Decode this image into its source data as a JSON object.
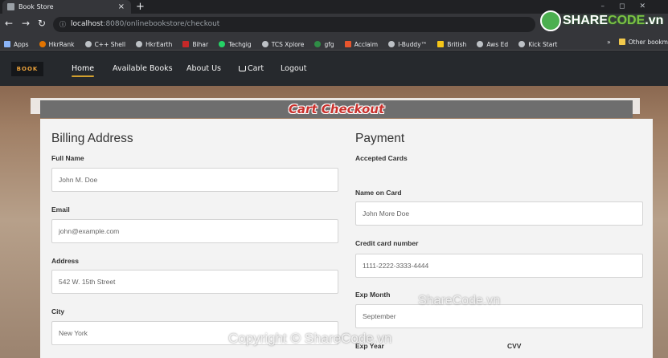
{
  "browser": {
    "tab_title": "Book Store",
    "tab_close": "×",
    "new_tab": "+",
    "url_host": "localhost",
    "url_rest": ":8080/onlinebookstore/checkout",
    "bookmarks": [
      "Apps",
      "HkrRank",
      "C++ Shell",
      "HkrEarth",
      "Bihar",
      "Techgig",
      "TCS Xplore",
      "gfg",
      "Acclaim",
      "I-Buddy™",
      "British",
      "Aws Ed",
      "Kick Start"
    ],
    "bookmarks_more": "»",
    "other_bookmarks": "Other bookm"
  },
  "navbar": {
    "brand": "BOOK",
    "links": [
      "Home",
      "Available Books",
      "About Us",
      "Cart",
      "Logout"
    ]
  },
  "checkout": {
    "title": "Cart Checkout",
    "billing": {
      "heading": "Billing Address",
      "full_name_label": "Full Name",
      "full_name_placeholder": "John M. Doe",
      "email_label": "Email",
      "email_placeholder": "john@example.com",
      "address_label": "Address",
      "address_placeholder": "542 W. 15th Street",
      "city_label": "City",
      "city_placeholder": "New York"
    },
    "payment": {
      "heading": "Payment",
      "accepted_cards_label": "Accepted Cards",
      "name_on_card_label": "Name on Card",
      "name_on_card_placeholder": "John More Doe",
      "card_number_label": "Credit card number",
      "card_number_placeholder": "1111-2222-3333-4444",
      "exp_month_label": "Exp Month",
      "exp_month_placeholder": "September",
      "exp_year_label": "Exp Year",
      "cvv_label": "CVV"
    }
  },
  "watermarks": {
    "logo_part1": "SHARE",
    "logo_part2": "CODE",
    "logo_part3": ".vn",
    "mid": "ShareCode.vn",
    "bottom": "Copyright © ShareCode.vn"
  }
}
